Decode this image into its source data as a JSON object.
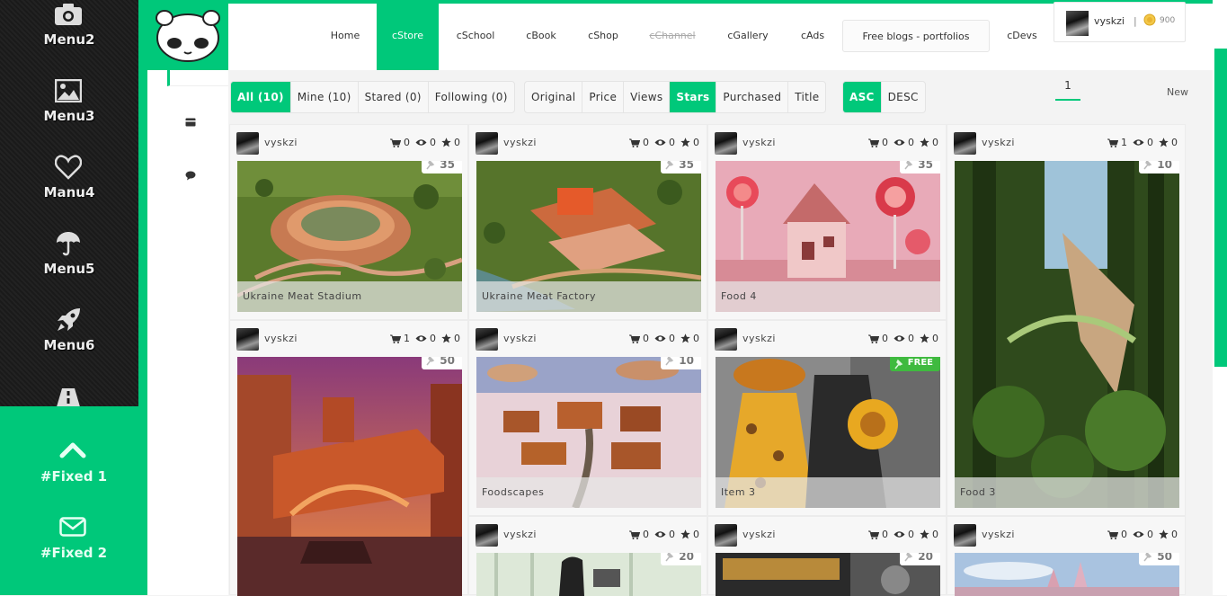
{
  "left_menu": {
    "items": [
      {
        "label": "Menu2",
        "icon": "camera-icon"
      },
      {
        "label": "Menu3",
        "icon": "image-icon"
      },
      {
        "label": "Manu4",
        "icon": "heart-icon"
      },
      {
        "label": "Menu5",
        "icon": "umbrella-icon"
      },
      {
        "label": "Menu6",
        "icon": "rocket-icon"
      },
      {
        "label": "",
        "icon": "road-icon"
      }
    ],
    "fixed": [
      {
        "label": "#Fixed 1",
        "icon": "chevron-up-icon"
      },
      {
        "label": "#Fixed 2",
        "icon": "envelope-icon"
      }
    ]
  },
  "header": {
    "nav": [
      {
        "label": "Home"
      },
      {
        "label": "cStore"
      },
      {
        "label": "cSchool"
      },
      {
        "label": "cBook"
      },
      {
        "label": "cShop"
      },
      {
        "label": "cChannel"
      },
      {
        "label": "cGallery"
      },
      {
        "label": "cAds"
      },
      {
        "label": "Free blogs - portfolios"
      },
      {
        "label": "cDevs"
      }
    ],
    "user": {
      "name": "vyskzi",
      "separator": "|",
      "coins": "900"
    }
  },
  "toolbar": {
    "filter": [
      "All (10)",
      "Mine (10)",
      "Stared (0)",
      "Following (0)"
    ],
    "sort": [
      "Original",
      "Price",
      "Views",
      "Stars",
      "Purchased",
      "Title"
    ],
    "order": [
      "ASC",
      "DESC"
    ],
    "page": "1",
    "new_label": "New"
  },
  "items": [
    {
      "user": "vyskzi",
      "cart": "0",
      "views": "0",
      "stars": "0",
      "count": "35",
      "caption": "Ukraine Meat Stadium"
    },
    {
      "user": "vyskzi",
      "cart": "0",
      "views": "0",
      "stars": "0",
      "count": "35",
      "caption": "Ukraine Meat Factory"
    },
    {
      "user": "vyskzi",
      "cart": "0",
      "views": "0",
      "stars": "0",
      "count": "35",
      "caption": "Food 4"
    },
    {
      "user": "vyskzi",
      "cart": "1",
      "views": "0",
      "stars": "0",
      "count": "10",
      "caption": "Food 3"
    },
    {
      "user": "vyskzi",
      "cart": "1",
      "views": "0",
      "stars": "0",
      "count": "50",
      "caption": ""
    },
    {
      "user": "vyskzi",
      "cart": "0",
      "views": "0",
      "stars": "0",
      "count": "10",
      "caption": "Foodscapes"
    },
    {
      "user": "vyskzi",
      "cart": "0",
      "views": "0",
      "stars": "0",
      "count": "FREE",
      "caption": "Item 3"
    },
    {
      "user": "vyskzi",
      "cart": "0",
      "views": "0",
      "stars": "0",
      "count": "20",
      "caption": ""
    },
    {
      "user": "vyskzi",
      "cart": "0",
      "views": "0",
      "stars": "0",
      "count": "20",
      "caption": ""
    },
    {
      "user": "vyskzi",
      "cart": "0",
      "views": "0",
      "stars": "0",
      "count": "50",
      "caption": ""
    }
  ],
  "colors": {
    "accent": "#00c87a",
    "sidebar": "#1a1a1a",
    "free_tag": "#3fba3f"
  }
}
